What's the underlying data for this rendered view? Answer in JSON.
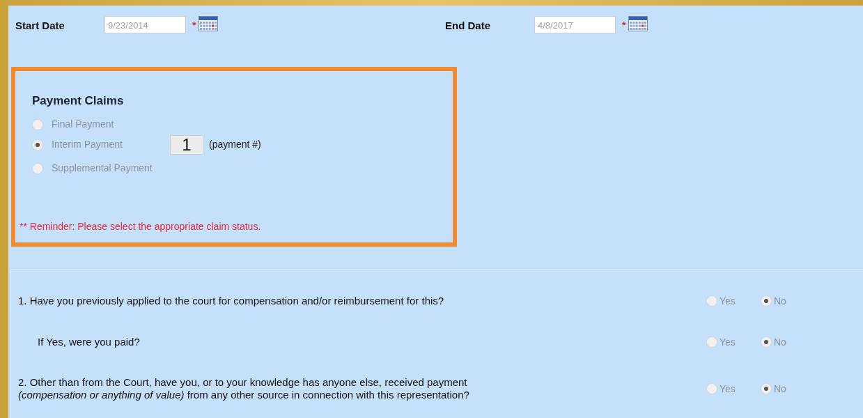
{
  "dates": [
    {
      "label": "Start Date",
      "value": "9/23/2014",
      "required_mark": "*"
    },
    {
      "label": "End Date",
      "value": "4/8/2017",
      "required_mark": "*"
    }
  ],
  "payment_claims": {
    "title": "Payment Claims",
    "options": [
      {
        "label": "Final Payment",
        "selected": false
      },
      {
        "label": "Interim Payment",
        "selected": true
      },
      {
        "label": "Supplemental Payment",
        "selected": false
      }
    ],
    "payment_number": "1",
    "payment_number_label": "(payment #)",
    "reminder": "** Reminder: Please select the appropriate claim status."
  },
  "questions": [
    {
      "text": "1. Have you previously applied to the court for compensation and/or reimbursement for this?",
      "indented": false,
      "options": [
        {
          "label": "Yes",
          "selected": false
        },
        {
          "label": "No",
          "selected": true
        }
      ]
    },
    {
      "text": "If Yes, were you paid?",
      "indented": true,
      "options": [
        {
          "label": "Yes",
          "selected": false
        },
        {
          "label": "No",
          "selected": true
        }
      ]
    },
    {
      "text": "2. Other than from the Court, have you, or to your knowledge has anyone else, received payment\n*(compensation or anything of value)* from any other source in connection with this representation?",
      "indented": false,
      "options": [
        {
          "label": "Yes",
          "selected": false
        },
        {
          "label": "No",
          "selected": true
        }
      ]
    }
  ]
}
